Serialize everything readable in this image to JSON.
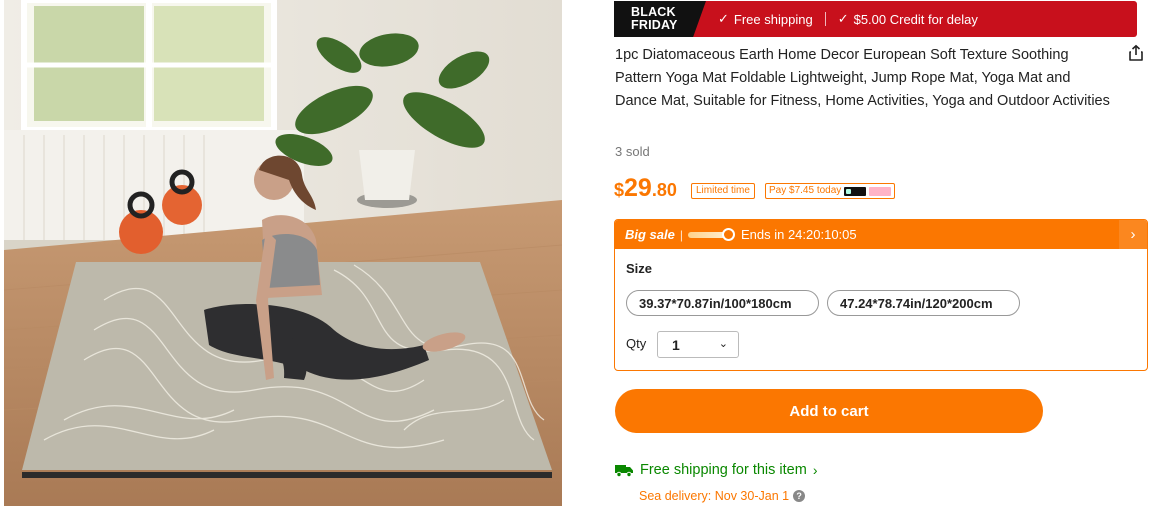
{
  "banner": {
    "badge_line1": "BLACK",
    "badge_line2": "FRIDAY",
    "free_shipping": "Free shipping",
    "credit": "$5.00 Credit for delay"
  },
  "product": {
    "title": "1pc Diatomaceous Earth Home Decor European Soft Texture Soothing Pattern Yoga Mat Foldable Lightweight, Jump Rope Mat, Yoga Mat and Dance Mat, Suitable for Fitness, Home Activities, Yoga and Outdoor Activities",
    "sold": "3 sold",
    "image_alt": "Woman stretching on a beige yoga mat with wave pattern in a sunlit room"
  },
  "price": {
    "currency": "$",
    "integer": "29",
    "decimal": ".80",
    "limited_tag": "Limited time",
    "pay_tag": "Pay $7.45 today"
  },
  "sale": {
    "title": "Big sale",
    "separator": "|",
    "ends": "Ends in 24:20:10:05",
    "size_label": "Size",
    "sizes": [
      "39.37*70.87in/100*180cm",
      "47.24*78.74in/120*200cm"
    ],
    "qty_label": "Qty",
    "qty_value": "1"
  },
  "actions": {
    "add_to_cart": "Add to cart"
  },
  "shipping": {
    "free_shipping_link": "Free shipping for this item",
    "sea_delivery": "Sea delivery: Nov 30-Jan 1"
  },
  "colors": {
    "accent_orange": "#fb7701",
    "banner_red": "#c8101c",
    "shipping_green": "#0a8800"
  },
  "icons": [
    "check-icon",
    "share-icon",
    "chevron-right-icon",
    "chevron-down-icon",
    "truck-icon",
    "help-icon",
    "afterpay-icon",
    "klarna-icon"
  ]
}
